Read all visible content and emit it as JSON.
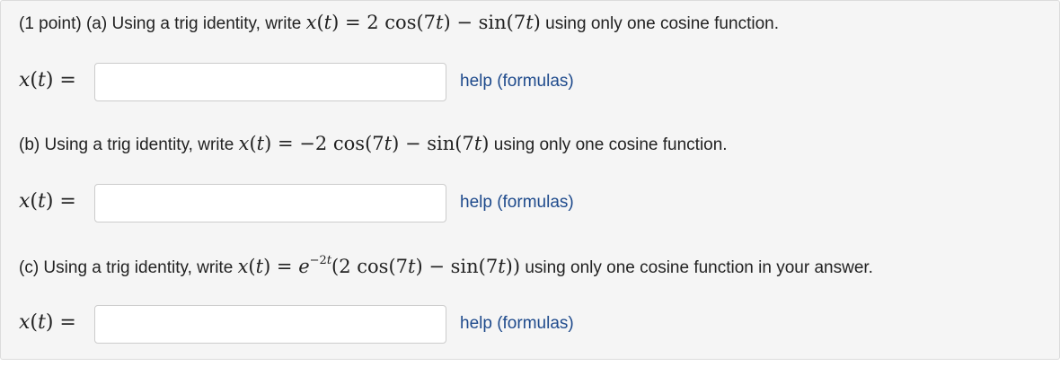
{
  "part_a": {
    "prefix": "(1 point) (a) Using a trig identity, write",
    "suffix": "using only one cosine function.",
    "answer_label": "x(t) =",
    "answer_value": "",
    "help_label": "help (formulas)"
  },
  "part_b": {
    "prefix": "(b) Using a trig identity, write",
    "suffix": "using only one cosine function.",
    "answer_label": "x(t) =",
    "answer_value": "",
    "help_label": "help (formulas)"
  },
  "part_c": {
    "prefix": "(c) Using a trig identity, write",
    "suffix": "using only one cosine function in your answer.",
    "answer_label": "x(t) =",
    "answer_value": "",
    "help_label": "help (formulas)"
  },
  "colors": {
    "link": "#1e4a8c",
    "panel_bg": "#f5f5f5",
    "panel_border": "#dcdcdc"
  }
}
